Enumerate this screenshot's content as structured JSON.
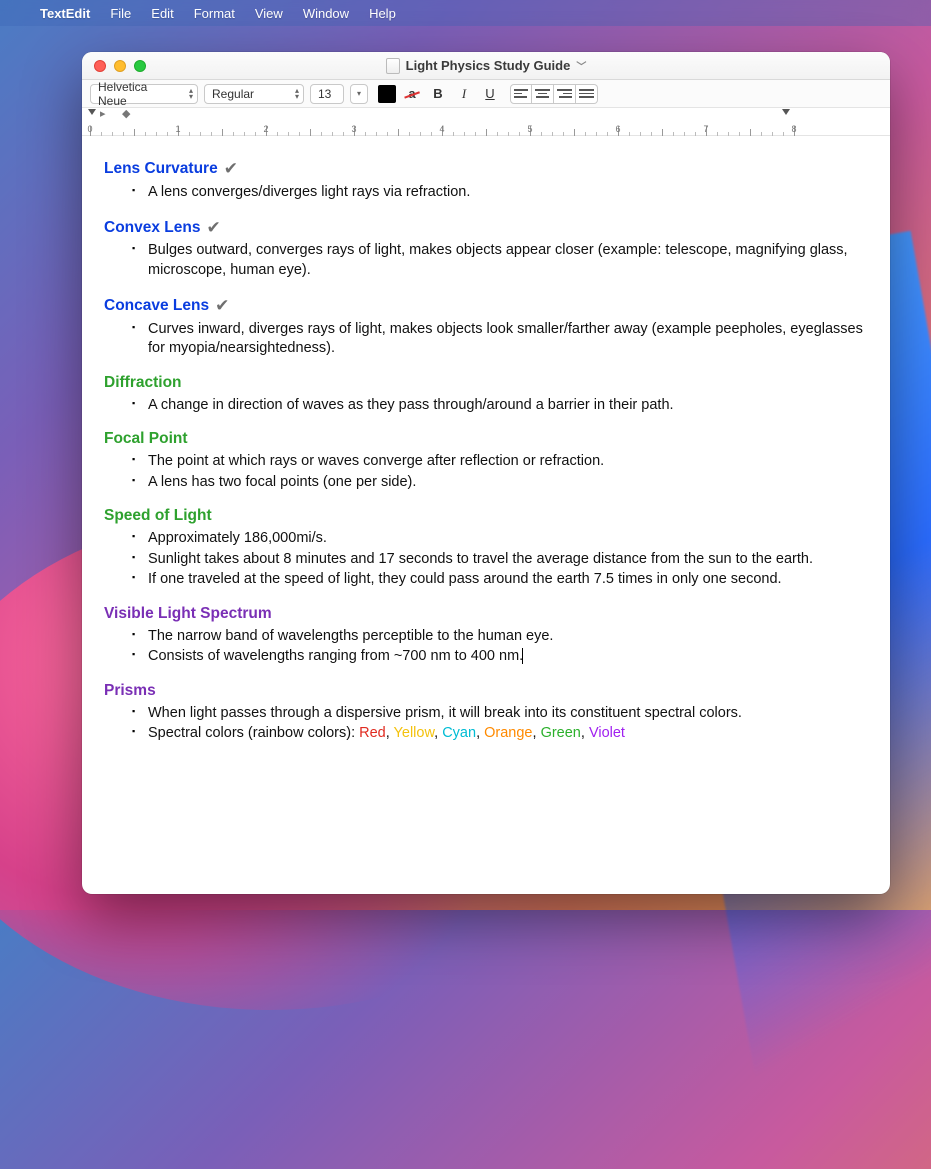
{
  "menubar": {
    "app_name": "TextEdit",
    "items": [
      "File",
      "Edit",
      "Format",
      "View",
      "Window",
      "Help"
    ]
  },
  "window": {
    "title": "Light Physics Study Guide"
  },
  "toolbar": {
    "font_family": "Helvetica Neue",
    "font_style": "Regular",
    "font_size": "13"
  },
  "ruler": {
    "marks": [
      "0",
      "1",
      "2",
      "3",
      "4",
      "5",
      "6",
      "7",
      "8"
    ]
  },
  "doc": {
    "sections": [
      {
        "heading": "Lens Curvature",
        "color": "blue",
        "check": true,
        "bullets": [
          "A lens converges/diverges light rays via refraction."
        ]
      },
      {
        "heading": "Convex Lens",
        "color": "blue",
        "check": true,
        "bullets": [
          "Bulges outward, converges rays of light, makes objects appear closer (example: telescope, magnifying glass, microscope, human eye)."
        ]
      },
      {
        "heading": "Concave Lens",
        "color": "blue",
        "check": true,
        "bullets": [
          "Curves inward, diverges rays of light, makes objects look smaller/farther away (example peepholes, eyeglasses for myopia/nearsightedness)."
        ]
      },
      {
        "heading": "Diffraction",
        "color": "green",
        "check": false,
        "bullets": [
          "A change in direction of waves as they pass through/around a barrier in their path."
        ]
      },
      {
        "heading": "Focal Point",
        "color": "green",
        "check": false,
        "bullets": [
          "The point at which rays or waves converge after reflection or refraction.",
          "A lens has two focal points (one per side)."
        ]
      },
      {
        "heading": "Speed of Light",
        "color": "green",
        "check": false,
        "bullets": [
          "Approximately 186,000mi/s.",
          "Sunlight takes about 8 minutes and 17 seconds to travel the average distance from the sun to the earth.",
          "If one traveled at the speed of light, they could pass around the earth 7.5 times in only one second."
        ]
      },
      {
        "heading": "Visible Light Spectrum",
        "color": "purple",
        "check": false,
        "bullets": [
          "The narrow band of wavelengths perceptible to the human eye.",
          "Consists of wavelengths ranging from ~700 nm to 400 nm."
        ],
        "caret_after": 1
      },
      {
        "heading": "Prisms",
        "color": "purple",
        "check": false,
        "bullets": [
          "When light passes through a dispersive prism, it will break into its constituent spectral colors."
        ],
        "spectral": {
          "prefix": "Spectral colors (rainbow colors): ",
          "colors": [
            {
              "text": "Red",
              "cls": "c-red"
            },
            {
              "text": "Yellow",
              "cls": "c-yellow"
            },
            {
              "text": "Cyan",
              "cls": "c-cyan"
            },
            {
              "text": "Orange",
              "cls": "c-orange"
            },
            {
              "text": "Green",
              "cls": "c-green"
            },
            {
              "text": "Violet",
              "cls": "c-violet"
            }
          ]
        }
      }
    ]
  }
}
